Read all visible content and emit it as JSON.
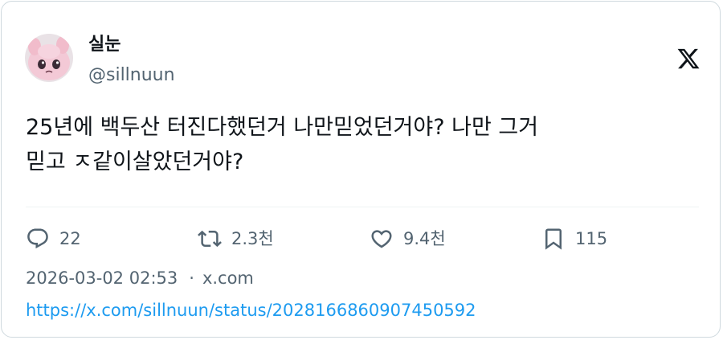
{
  "author": {
    "display_name": "실눈",
    "handle": "@sillnuun"
  },
  "brand": {
    "logo_icon": "x-logo-icon"
  },
  "tweet": {
    "text_lines": [
      "25년에 백두산 터진다했던거 나만믿었던거야? 나만 그거",
      "믿고 ㅈ같이살았던거야?"
    ]
  },
  "actions": {
    "replies": {
      "icon": "reply-icon",
      "count": "22"
    },
    "reposts": {
      "icon": "repost-icon",
      "count": "2.3천"
    },
    "likes": {
      "icon": "heart-icon",
      "count": "9.4천"
    },
    "bookmarks": {
      "icon": "bookmark-icon",
      "count": "115"
    }
  },
  "meta": {
    "timestamp": "2026-03-02 02:53",
    "separator": "·",
    "source": "x.com"
  },
  "link": {
    "url": "https://x.com/sillnuun/status/2028166860907450592"
  },
  "colors": {
    "text": "#0f1419",
    "secondary": "#536471",
    "link": "#1d9bf0",
    "border": "#cfd9de",
    "avatar_pink": "#f3c9d6"
  }
}
